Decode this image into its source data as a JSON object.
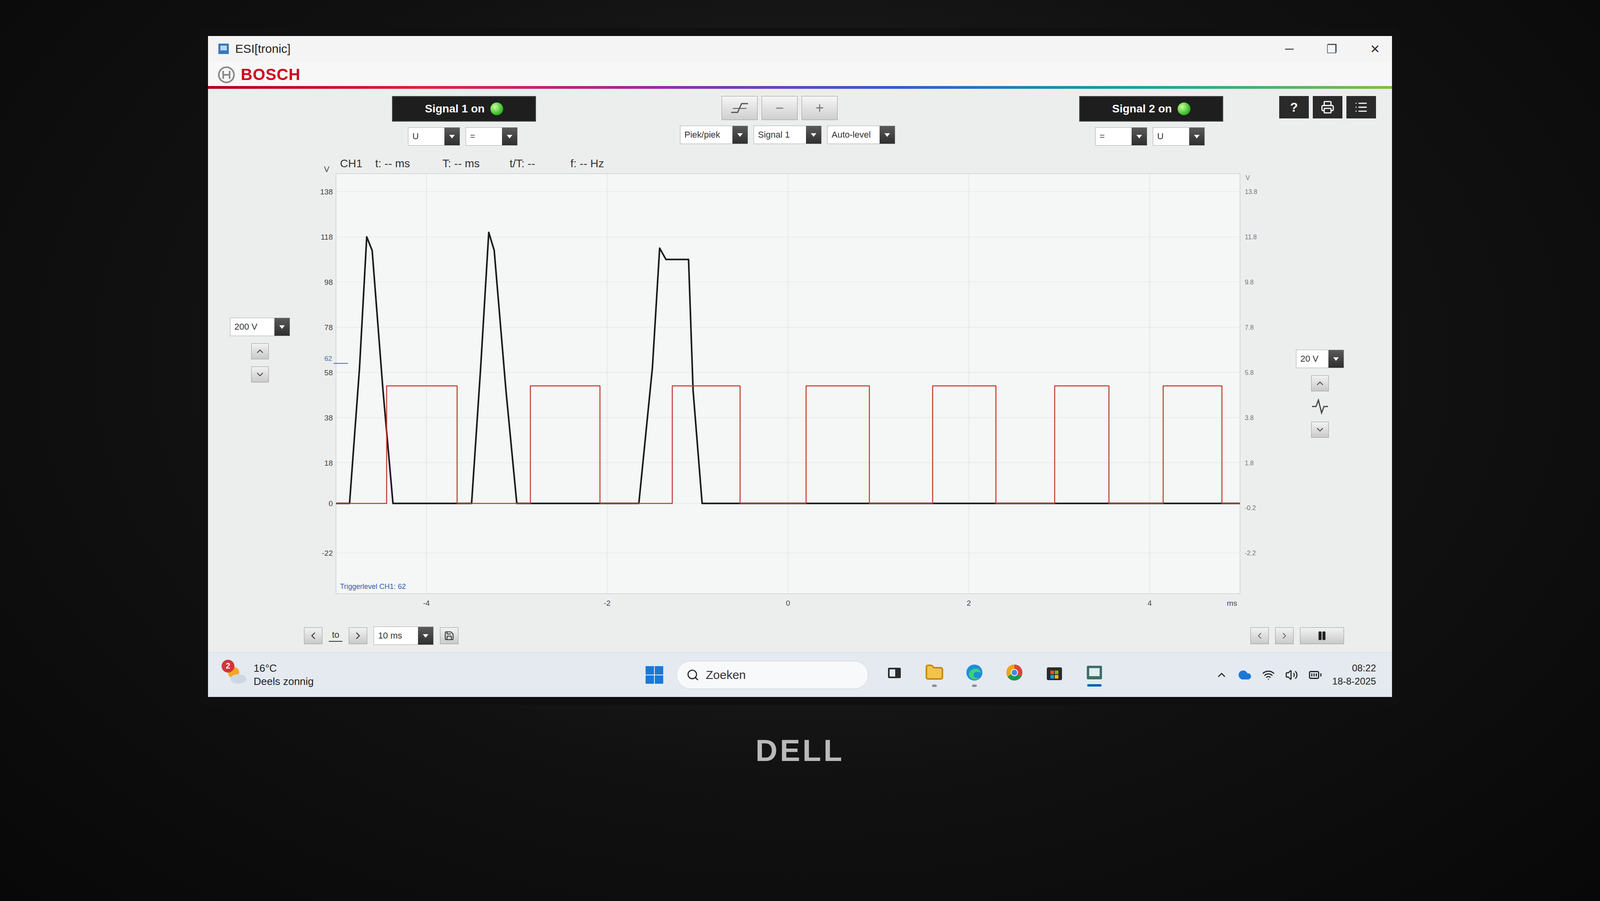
{
  "window": {
    "title": "ESI[tronic]",
    "controls": [
      "─",
      "❐",
      "✕"
    ]
  },
  "header": {
    "logo": "BOSCH"
  },
  "signal1": {
    "label": "Signal 1 on",
    "on": true,
    "selects": [
      "U",
      "="
    ]
  },
  "toolbar": {
    "buttons": [
      "−",
      "+"
    ],
    "selects": [
      "Piek/piek",
      "Signal 1",
      "Auto-level"
    ]
  },
  "signal2": {
    "label": "Signal 2 on",
    "on": true,
    "selects": [
      "=",
      "U"
    ]
  },
  "actions": [
    "?"
  ],
  "left_range": {
    "value": "200 V"
  },
  "right_range": {
    "value": "20 V"
  },
  "chart": {
    "info": [
      "CH1",
      "t: -- ms",
      "T: -- ms",
      "t/T: --",
      "f: -- Hz"
    ],
    "unit_left": "V",
    "unit_right": "V",
    "x_unit": "ms",
    "trigger_label": "Triggerlevel CH1: 62",
    "trigger": {
      "label": "62",
      "value": 62
    },
    "left_axis": {
      "min": -40,
      "max": 146,
      "ticks": [
        {
          "label": "138",
          "value": 138
        },
        {
          "label": "118",
          "value": 118
        },
        {
          "label": "98",
          "value": 98
        },
        {
          "label": "78",
          "value": 78
        },
        {
          "label": "58",
          "value": 58
        },
        {
          "label": "38",
          "value": 38
        },
        {
          "label": "18",
          "value": 18
        },
        {
          "label": "0",
          "value": 0
        },
        {
          "label": "-22",
          "value": -22
        }
      ]
    },
    "right_axis": {
      "min": -4,
      "max": 14.6,
      "ticks": [
        {
          "label": "13.8",
          "value": 13.8
        },
        {
          "label": "11.8",
          "value": 11.8
        },
        {
          "label": "9.8",
          "value": 9.8
        },
        {
          "label": "7.8",
          "value": 7.8
        },
        {
          "label": "5.8",
          "value": 5.8
        },
        {
          "label": "3.8",
          "value": 3.8
        },
        {
          "label": "1.8",
          "value": 1.8
        },
        {
          "label": "-0.2",
          "value": -0.2
        },
        {
          "label": "-2.2",
          "value": -2.2
        }
      ]
    },
    "x_axis": {
      "min": -5,
      "max": 5,
      "ticks": [
        {
          "label": "-4",
          "value": -4
        },
        {
          "label": "-2",
          "value": -2
        },
        {
          "label": "0",
          "value": 0
        },
        {
          "label": "2",
          "value": 2
        },
        {
          "label": "4",
          "value": 4
        }
      ]
    },
    "series": [
      {
        "name": "Signal 1",
        "color": "#1a1a1a",
        "axis": "left",
        "times": [
          -5,
          -4.85,
          -4.74,
          -4.66,
          -4.6,
          -4.48,
          -4.37,
          -3.5,
          -3.4,
          -3.31,
          -3.25,
          -3.12,
          -3.0,
          -1.65,
          -1.5,
          -1.42,
          -1.35,
          -1.1,
          -1.05,
          -0.95,
          1,
          5
        ],
        "values": [
          0,
          0,
          60,
          118,
          112,
          50,
          0,
          0,
          60,
          120,
          112,
          50,
          0,
          0,
          60,
          113,
          108,
          108,
          50,
          0,
          0,
          0
        ]
      },
      {
        "name": "Signal 2",
        "color": "#c0392b",
        "axis": "right",
        "times": [
          -5,
          -4.44,
          -4.44,
          -3.66,
          -3.66,
          -2.85,
          -2.85,
          -2.08,
          -2.08,
          -1.28,
          -1.28,
          -0.53,
          -0.53,
          0.2,
          0.2,
          0.9,
          0.9,
          1.6,
          1.6,
          2.3,
          2.3,
          2.95,
          2.95,
          3.55,
          3.55,
          4.15,
          4.15,
          4.8,
          4.8,
          5
        ],
        "values": [
          0,
          0,
          5.2,
          5.2,
          0,
          0,
          5.2,
          5.2,
          0,
          0,
          5.2,
          5.2,
          0,
          0,
          5.2,
          5.2,
          0,
          0,
          5.2,
          5.2,
          0,
          0,
          5.2,
          5.2,
          0,
          0,
          5.2,
          5.2,
          0,
          0
        ]
      }
    ]
  },
  "timebase": {
    "marker": "to",
    "value": "10 ms"
  },
  "taskbar": {
    "weather": {
      "badge": "2",
      "temperature": "16°C",
      "condition": "Deels zonnig"
    },
    "search": {
      "placeholder": "Zoeken"
    },
    "apps": [
      {
        "kind": "taskview",
        "running": false,
        "active": false
      },
      {
        "kind": "explorer",
        "running": true,
        "active": false
      },
      {
        "kind": "edge",
        "running": true,
        "active": false
      },
      {
        "kind": "chrome",
        "running": false,
        "active": false
      },
      {
        "kind": "store",
        "running": false,
        "active": false
      },
      {
        "kind": "esi",
        "running": true,
        "active": true
      }
    ],
    "time": "08:22",
    "date": "18-8-2025"
  },
  "laptop": {
    "brand": "DELL"
  }
}
